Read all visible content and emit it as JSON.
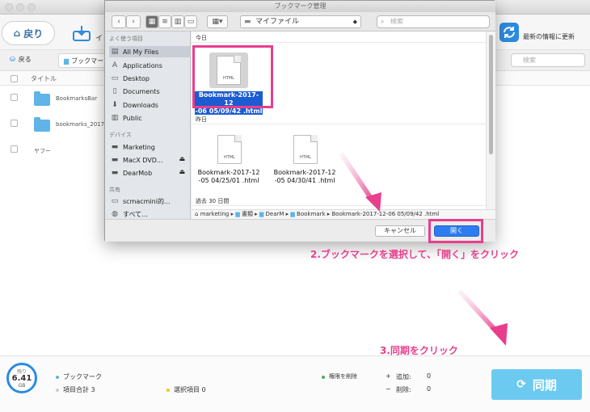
{
  "window": {
    "title": "ブックマーク管理"
  },
  "toolbar": {
    "back_label": "戻り",
    "import_label": "イ",
    "refresh_label": "最新の情報に更新"
  },
  "subbar": {
    "back_label": "戻る",
    "tab_label": "ブックマー",
    "search_placeholder": "検索"
  },
  "table": {
    "header_title": "タイトル",
    "rows": [
      {
        "label": "BookmarksBar"
      },
      {
        "label": "bookmarks_201711"
      },
      {
        "label": "ヤフー"
      }
    ]
  },
  "dialog": {
    "title": "ブックマーク管理",
    "location": "マイファイル",
    "search_placeholder": "検索",
    "view_buttons": [
      "icon-view",
      "list-view",
      "column-view",
      "coverflow-view"
    ],
    "sidebar": {
      "favorites_heading": "よく使う項目",
      "favorites": [
        {
          "label": "All My Files",
          "icon": "all-files-icon",
          "selected": true
        },
        {
          "label": "Applications",
          "icon": "applications-icon"
        },
        {
          "label": "Desktop",
          "icon": "desktop-icon"
        },
        {
          "label": "Documents",
          "icon": "documents-icon"
        },
        {
          "label": "Downloads",
          "icon": "downloads-icon"
        },
        {
          "label": "Public",
          "icon": "public-icon"
        }
      ],
      "devices_heading": "デバイス",
      "devices": [
        {
          "label": "Marketing",
          "icon": "drive-icon"
        },
        {
          "label": "MacX DVD...",
          "icon": "drive-icon",
          "eject": true
        },
        {
          "label": "DearMob",
          "icon": "drive-icon",
          "eject": true
        }
      ],
      "shared_heading": "共有",
      "shared": [
        {
          "label": "scmacmini的...",
          "icon": "network-icon"
        },
        {
          "label": "すべて...",
          "icon": "network-icon"
        }
      ]
    },
    "sections": [
      {
        "label": "今日"
      },
      {
        "label": "昨日"
      },
      {
        "label": "過去 30 日間"
      }
    ],
    "files": [
      {
        "type": "HTML",
        "line1": "Bookmark-2017-12",
        "line2": "-06 05/09/42 .html",
        "selected": true
      },
      {
        "type": "HTML",
        "line1": "Bookmark-2017-12",
        "line2": "-05 04/25/01 .html",
        "selected": false
      },
      {
        "type": "HTML",
        "line1": "Bookmark-2017-12",
        "line2": "-05 04/30/41 .html",
        "selected": false
      }
    ],
    "path": [
      "marketing",
      "書類",
      "DearM",
      "Bookmark",
      "Bookmark-2017-12-06 05/09/42 .html"
    ],
    "cancel_label": "キャンセル",
    "open_label": "開く"
  },
  "annotations": {
    "step2": "2.ブックマークを選択して、「開く」をクリック",
    "step3": "3.同期をクリック"
  },
  "status": {
    "gauge_label": "残り",
    "gauge_value": "6.41",
    "gauge_unit": "GB",
    "bookmark_label": "ブックマーク",
    "total_label": "項目合計 3",
    "selected_label": "選択項目 0",
    "delete_perm_label": "権限を削除",
    "added_label": "追加:",
    "added_value": "0",
    "deleted_label": "削除:",
    "deleted_value": "0",
    "sync_label": "同期"
  },
  "colors": {
    "accent": "#2d7df0",
    "highlight": "#e83e8c",
    "sync": "#6ccaf1",
    "folder": "#5fb4e8"
  }
}
